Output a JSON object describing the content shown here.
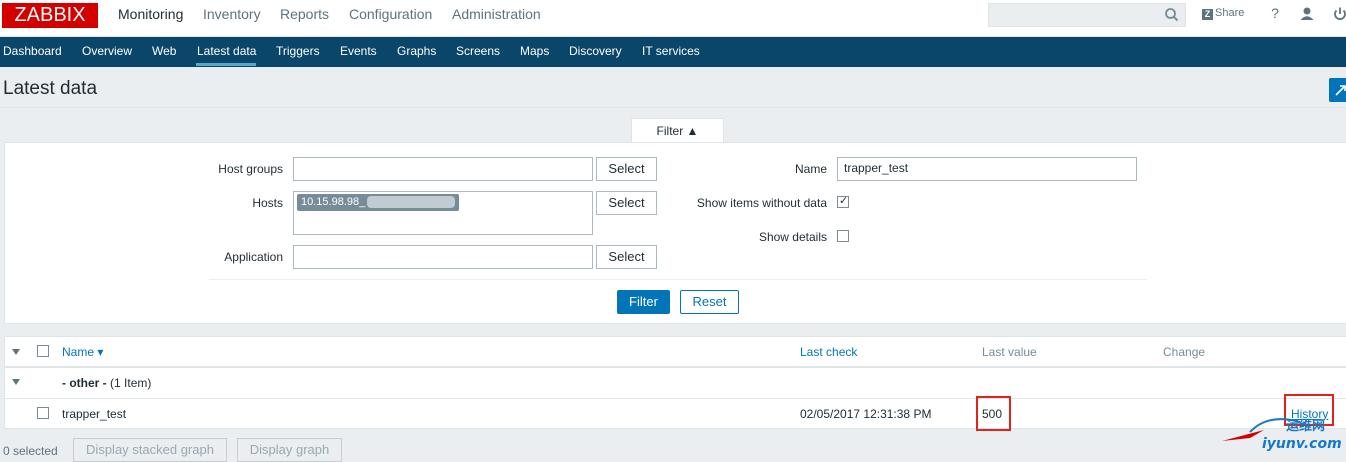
{
  "brand": {
    "logo_text": "ZABBIX",
    "logo_color": "#d40000"
  },
  "top_nav": [
    {
      "label": "Monitoring",
      "active": true
    },
    {
      "label": "Inventory"
    },
    {
      "label": "Reports"
    },
    {
      "label": "Configuration"
    },
    {
      "label": "Administration"
    }
  ],
  "header_tools": {
    "search_placeholder": "",
    "share_label": "Share",
    "help": "?",
    "icons": [
      "search-icon",
      "share-icon",
      "help-icon",
      "user-icon",
      "power-icon"
    ]
  },
  "sub_nav": [
    {
      "label": "Dashboard"
    },
    {
      "label": "Overview"
    },
    {
      "label": "Web"
    },
    {
      "label": "Latest data",
      "active": true
    },
    {
      "label": "Triggers"
    },
    {
      "label": "Events"
    },
    {
      "label": "Graphs"
    },
    {
      "label": "Screens"
    },
    {
      "label": "Maps"
    },
    {
      "label": "Discovery"
    },
    {
      "label": "IT services"
    }
  ],
  "page": {
    "title": "Latest data"
  },
  "filter": {
    "tab_label": "Filter ▲",
    "host_groups_label": "Host groups",
    "host_groups_value": "",
    "hosts_label": "Hosts",
    "hosts_tag": "10.15.98.98_",
    "application_label": "Application",
    "application_value": "",
    "select_label": "Select",
    "name_label": "Name",
    "name_value": "trapper_test",
    "show_without_data_label": "Show items without data",
    "show_without_data_checked": true,
    "show_details_label": "Show details",
    "show_details_checked": false,
    "filter_button": "Filter",
    "reset_button": "Reset"
  },
  "table": {
    "columns": {
      "name": "Name ▾",
      "last_check": "Last check",
      "last_value": "Last value",
      "change": "Change"
    },
    "group": {
      "name": "- other -",
      "count": "(1 Item)"
    },
    "rows": [
      {
        "name": "trapper_test",
        "last_check": "02/05/2017 12:31:38 PM",
        "last_value": "500",
        "change": "",
        "history": "History"
      }
    ]
  },
  "footer": {
    "selected_text": "0 selected",
    "stacked_graph_button": "Display stacked graph",
    "graph_button": "Display graph"
  },
  "watermark": {
    "text": "运维网",
    "url": "iyunv.com"
  }
}
